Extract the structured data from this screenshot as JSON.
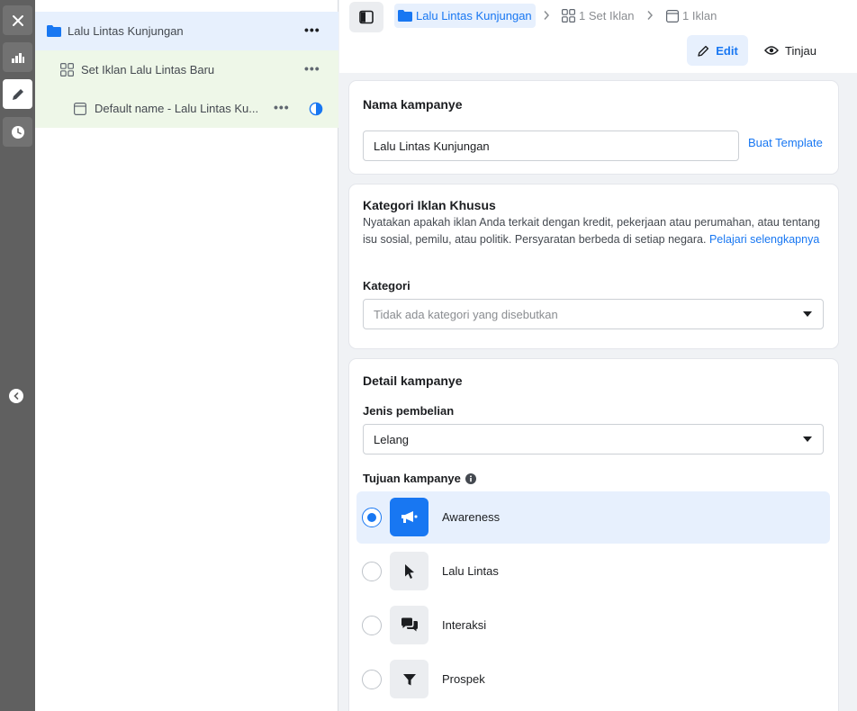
{
  "tree": {
    "campaign": {
      "label": "Lalu Lintas Kunjungan",
      "menu": "•••"
    },
    "adset": {
      "label": "Set Iklan Lalu Lintas Baru",
      "menu": "•••"
    },
    "ad": {
      "label": "Default name - Lalu Lintas Ku...",
      "menu": "•••"
    }
  },
  "breadcrumb": {
    "campaign": "Lalu Lintas Kunjungan",
    "adset": "1 Set Iklan",
    "ad": "1 Iklan"
  },
  "toolbar": {
    "edit_label": "Edit",
    "review_label": "Tinjau"
  },
  "campaign_name": {
    "title": "Nama kampanye",
    "value": "Lalu Lintas Kunjungan",
    "template_link": "Buat Template"
  },
  "special_category": {
    "title": "Kategori Iklan Khusus",
    "description": "Nyatakan apakah iklan Anda terkait dengan kredit, pekerjaan atau perumahan, atau tentang isu sosial, pemilu, atau politik. Persyaratan berbeda di setiap negara.",
    "learn_more": "Pelajari selengkapnya",
    "category_label": "Kategori",
    "category_value": "Tidak ada kategori yang disebutkan"
  },
  "details": {
    "title": "Detail kampanye",
    "purchase_label": "Jenis pembelian",
    "purchase_value": "Lelang",
    "objective_label": "Tujuan kampanye",
    "objectives": [
      {
        "label": "Awareness",
        "icon": "megaphone-icon",
        "selected": true
      },
      {
        "label": "Lalu Lintas",
        "icon": "cursor-icon",
        "selected": false
      },
      {
        "label": "Interaksi",
        "icon": "chat-bubbles-icon",
        "selected": false
      },
      {
        "label": "Prospek",
        "icon": "funnel-icon",
        "selected": false
      }
    ]
  },
  "colors": {
    "accent": "#1877f2",
    "rail": "#606060",
    "selected_bg": "#e7f0fd",
    "tree_child_bg": "#eef7e8"
  }
}
